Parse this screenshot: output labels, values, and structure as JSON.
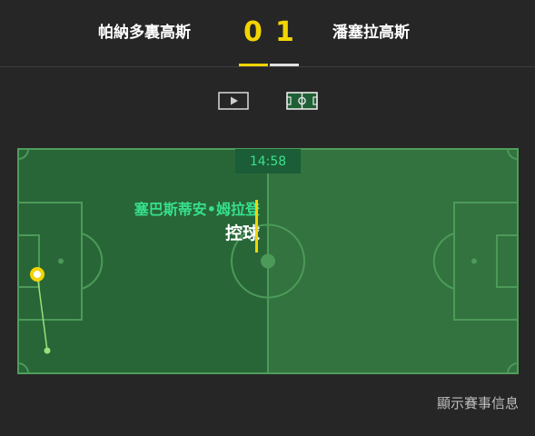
{
  "match": {
    "home_team": "帕納多裏高斯",
    "away_team": "潘塞拉高斯",
    "home_score": "0",
    "away_score": "1",
    "home_color": "#f3d400",
    "away_color": "#e0e0e0"
  },
  "view_toggle": {
    "video_icon": "play-video-icon",
    "pitch_icon": "pitch-view-icon",
    "active": "pitch"
  },
  "pitch": {
    "clock": "14:58",
    "event_player": "塞巴斯蒂安•姆拉登",
    "event_action": "控球",
    "possession_half": "home",
    "colors": {
      "pitch": "#33733f",
      "possession_overlay": "#286638",
      "lines": "#4c9a58",
      "ball": "#f3d400",
      "trail": "#9be07a"
    }
  },
  "footer": {
    "info_label": "顯示賽事信息"
  }
}
